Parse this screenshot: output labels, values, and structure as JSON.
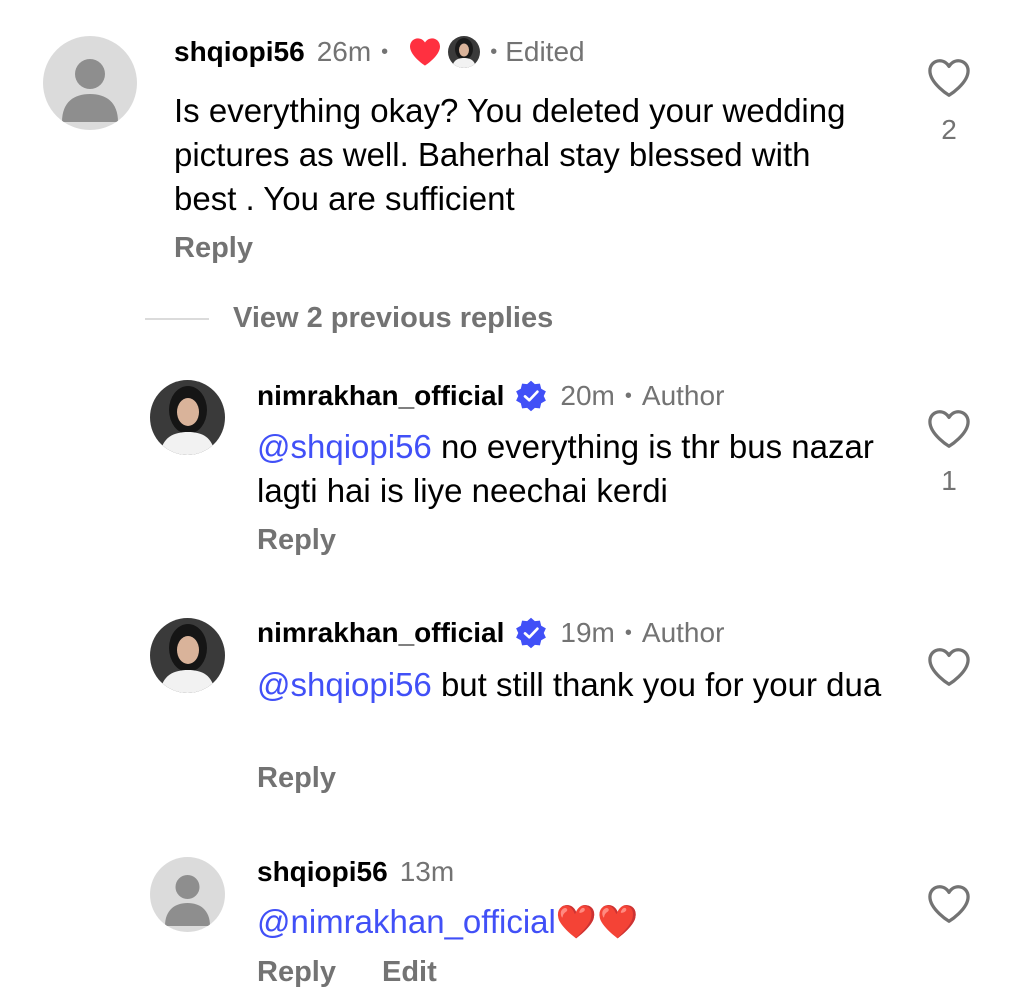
{
  "comments": [
    {
      "username": "shqiopi56",
      "time": "26m",
      "dot": "•",
      "edited_dot": "•",
      "edited": "Edited",
      "text": "Is everything okay? You deleted your wedding pictures as well. Baherhal stay blessed with best . You are sufficient",
      "like_count": "2",
      "reply_label": "Reply"
    }
  ],
  "view_previous": "View 2 previous replies",
  "replies": [
    {
      "username": "nimrakhan_official",
      "time": "20m",
      "dot": "•",
      "badge": "Author",
      "mention": "@shqiopi56",
      "text": " no everything is thr bus nazar lagti hai is liye neechai kerdi",
      "like_count": "1",
      "reply_label": "Reply"
    },
    {
      "username": "nimrakhan_official",
      "time": "19m",
      "dot": "•",
      "badge": "Author",
      "mention": "@shqiopi56",
      "text": " but still thank you for your dua",
      "reply_label": "Reply"
    },
    {
      "username": "shqiopi56",
      "time": "13m",
      "mention": "@nimrakhan_official",
      "text": "❤️❤️",
      "reply_label": "Reply",
      "edit_label": "Edit"
    }
  ],
  "colors": {
    "meta": "#737373",
    "mention": "#4150f7",
    "verified": "#4150f7",
    "like_red": "#ff3040"
  }
}
